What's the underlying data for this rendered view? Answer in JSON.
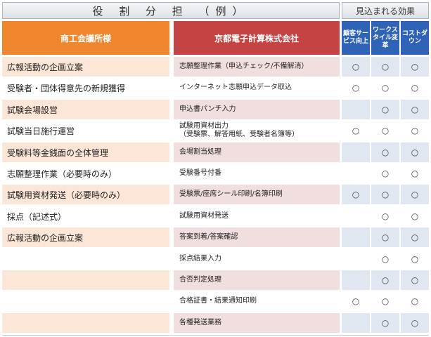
{
  "title": "役 割 分 担 （例）",
  "effects_title": "見込まれる効果",
  "client_header": "商工会議所様",
  "vendor_header": "京都電子計算株式会社",
  "effect_headers": [
    "顧客サービス向上",
    "ワークスタイル変革",
    "コストダウン"
  ],
  "colors": {
    "client": "#f0872f",
    "vendor": "#c44444",
    "effects": "#2f63b7"
  },
  "mark": "○",
  "client_tasks": [
    "広報活動の企画立案",
    "受験者・団体得意先の新規獲得",
    "試験会場設営",
    "試験当日施行運営",
    "受験料等金銭面の全体管理",
    "志願整理作業（必要時のみ）",
    "試験用資材発送（必要時のみ）",
    "採点（記述式）",
    "広報活動の企画立案",
    "",
    "",
    "",
    ""
  ],
  "vendor_tasks": [
    {
      "label": "志願整理作業（申込チェック/不備解消）",
      "marks": [
        true,
        true,
        true
      ]
    },
    {
      "label": "インターネット志願申込データ取込",
      "marks": [
        true,
        true,
        true
      ]
    },
    {
      "label": "申込書パンチ入力",
      "marks": [
        false,
        true,
        true
      ]
    },
    {
      "label": "試験用資材出力\n（受験票、解答用紙、受験者名簿等）",
      "marks": [
        true,
        true,
        true
      ]
    },
    {
      "label": "会場割当処理",
      "marks": [
        false,
        true,
        true
      ]
    },
    {
      "label": "受験番号付番",
      "marks": [
        false,
        true,
        true
      ]
    },
    {
      "label": "受験票/座席シール印刷/名簿印刷",
      "marks": [
        true,
        true,
        true
      ]
    },
    {
      "label": "試験用資材発送",
      "marks": [
        false,
        true,
        true
      ]
    },
    {
      "label": "答案到着/答案確認",
      "marks": [
        false,
        true,
        true
      ]
    },
    {
      "label": "採点結果入力",
      "marks": [
        false,
        true,
        true
      ]
    },
    {
      "label": "合否判定処理",
      "marks": [
        false,
        true,
        true
      ]
    },
    {
      "label": "合格証書・結果通知印刷",
      "marks": [
        true,
        true,
        true
      ]
    },
    {
      "label": "各種発送業務",
      "marks": [
        false,
        true,
        true
      ]
    }
  ]
}
